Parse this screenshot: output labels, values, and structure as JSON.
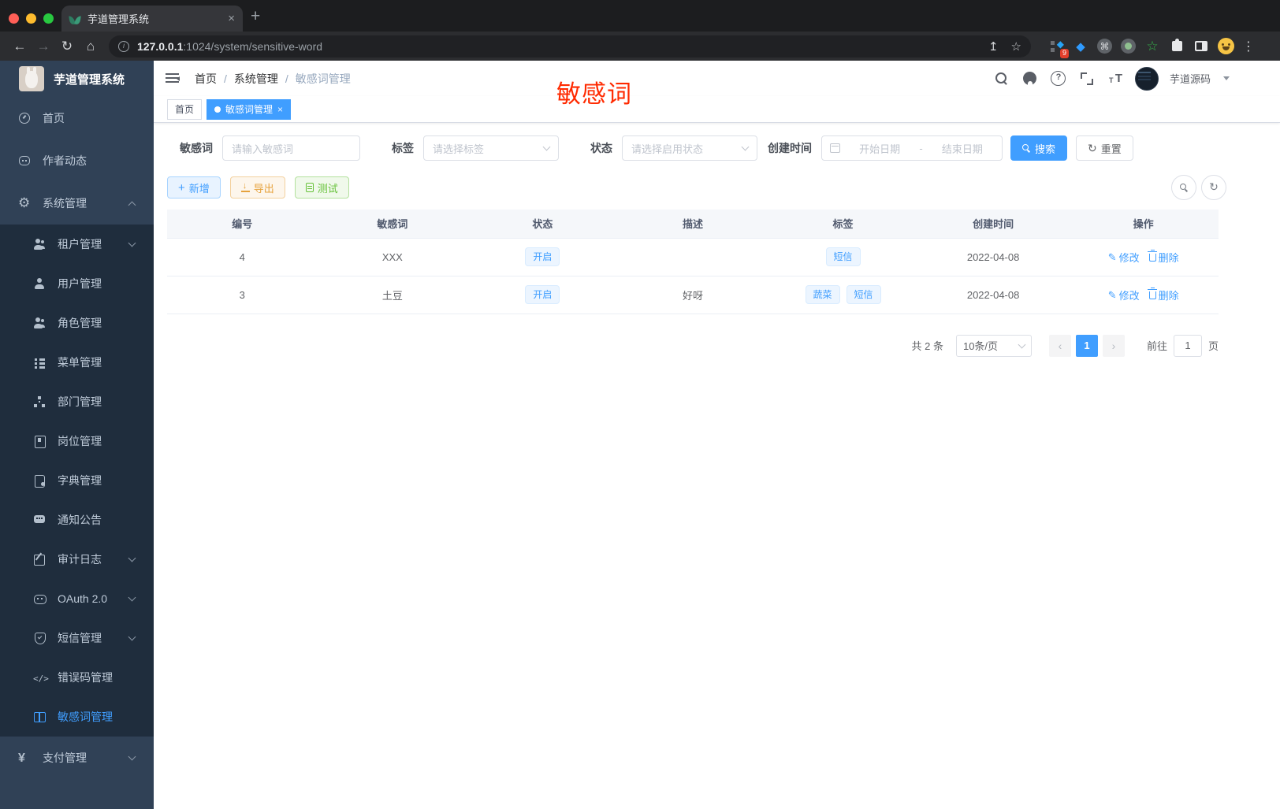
{
  "browser": {
    "tab_title": "芋道管理系统",
    "url_host": "127.0.0.1",
    "url_rest": ":1024/system/sensitive-word",
    "ext_badge_count": "9"
  },
  "sidebar": {
    "logo_title": "芋道管理系统",
    "items": [
      {
        "label": "首页"
      },
      {
        "label": "作者动态"
      },
      {
        "label": "系统管理"
      },
      {
        "label": "租户管理"
      },
      {
        "label": "用户管理"
      },
      {
        "label": "角色管理"
      },
      {
        "label": "菜单管理"
      },
      {
        "label": "部门管理"
      },
      {
        "label": "岗位管理"
      },
      {
        "label": "字典管理"
      },
      {
        "label": "通知公告"
      },
      {
        "label": "审计日志"
      },
      {
        "label": "OAuth 2.0"
      },
      {
        "label": "短信管理"
      },
      {
        "label": "错误码管理"
      },
      {
        "label": "敏感词管理"
      },
      {
        "label": "支付管理"
      }
    ]
  },
  "navbar": {
    "breadcrumb": [
      "首页",
      "系统管理",
      "敏感词管理"
    ],
    "username": "芋道源码",
    "annotation": "敏感词"
  },
  "tags": {
    "home": "首页",
    "active": "敏感词管理"
  },
  "filters": {
    "keyword_label": "敏感词",
    "keyword_placeholder": "请输入敏感词",
    "tag_label": "标签",
    "tag_placeholder": "请选择标签",
    "status_label": "状态",
    "status_placeholder": "请选择启用状态",
    "date_label": "创建时间",
    "date_start_placeholder": "开始日期",
    "date_separator": "-",
    "date_end_placeholder": "结束日期",
    "search_label": "搜索",
    "reset_label": "重置"
  },
  "toolbar": {
    "add_label": "新增",
    "export_label": "导出",
    "test_label": "测试"
  },
  "table": {
    "columns": [
      "编号",
      "敏感词",
      "状态",
      "描述",
      "标签",
      "创建时间",
      "操作"
    ],
    "rows": [
      {
        "id": "4",
        "word": "XXX",
        "status": "开启",
        "description": "",
        "tags": [
          "短信"
        ],
        "created": "2022-04-08"
      },
      {
        "id": "3",
        "word": "土豆",
        "status": "开启",
        "description": "好呀",
        "tags": [
          "蔬菜",
          "短信"
        ],
        "created": "2022-04-08"
      }
    ],
    "edit_label": "修改",
    "delete_label": "删除"
  },
  "pagination": {
    "total": "共 2 条",
    "page_size": "10条/页",
    "current_page": "1",
    "goto_label": "前往",
    "goto_value": "1",
    "page_unit": "页"
  },
  "colors": {
    "accent": "#409eff",
    "annotation_red": "#ff2a00",
    "warning": "#e6a23c",
    "success": "#67c23a",
    "sidebar_bg": "#304156",
    "submenu_bg": "#1f2d3d"
  }
}
